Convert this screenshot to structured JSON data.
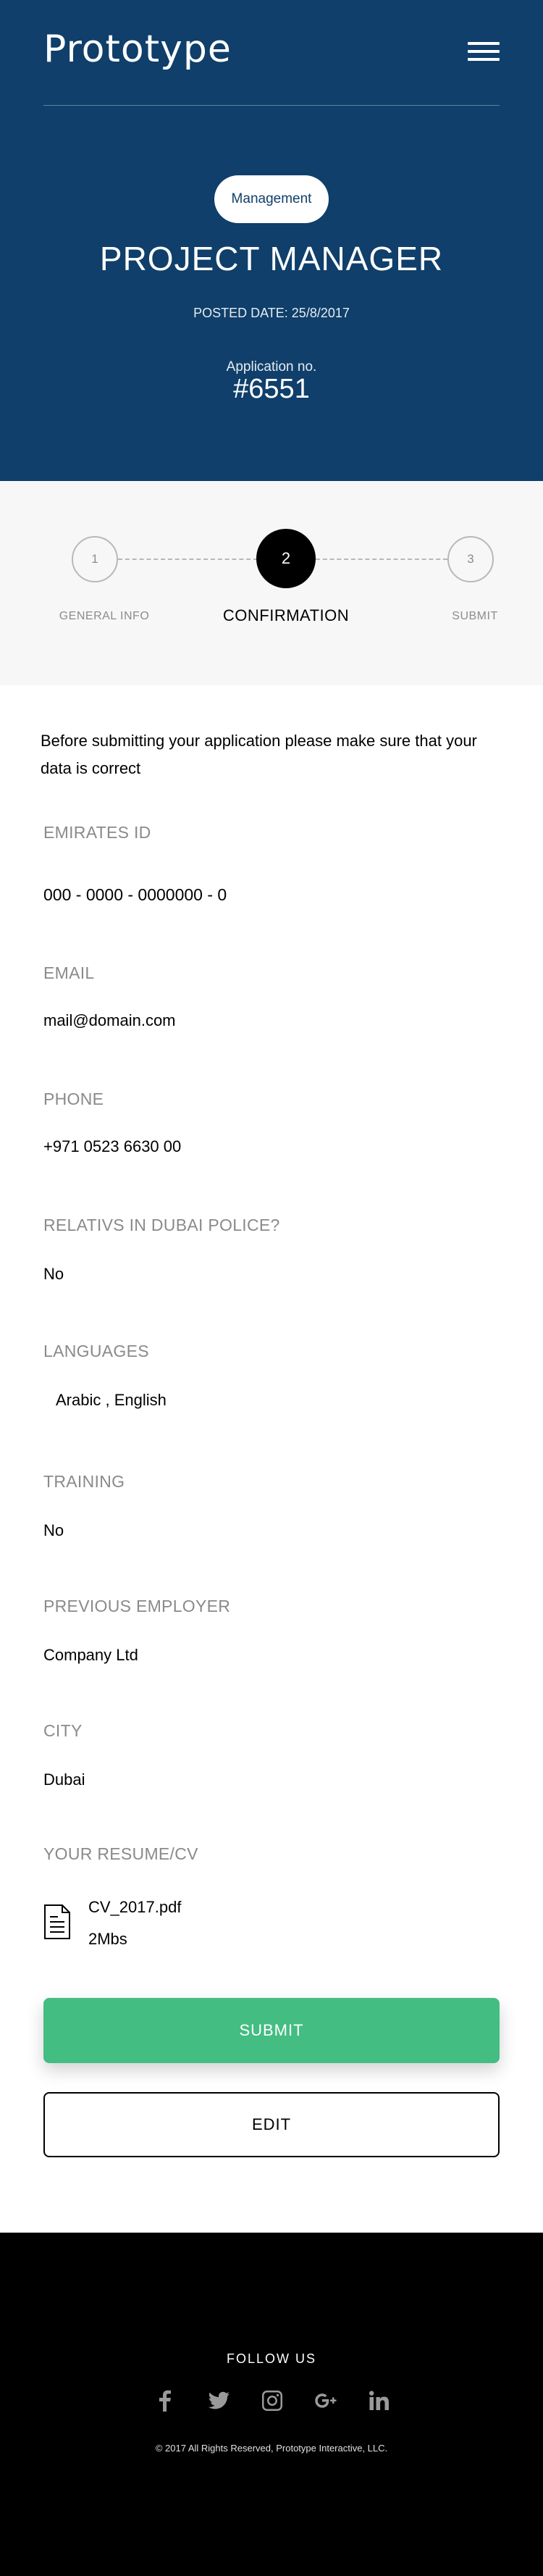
{
  "header": {
    "logo": "Prototype",
    "menu_icon": "hamburger-menu-icon",
    "category_tag": "Management",
    "job_title": "PROJECT MANAGER",
    "posted_date": "POSTED DATE: 25/8/2017",
    "application_label": "Application no.",
    "application_number": "#6551",
    "background_color": "#0f3f6a"
  },
  "stepper": {
    "steps": [
      {
        "number": "1",
        "label": "GENERAL INFO",
        "active": false
      },
      {
        "number": "2",
        "label": "CONFIRMATION",
        "active": true
      },
      {
        "number": "3",
        "label": "SUBMIT",
        "active": false
      }
    ]
  },
  "review": {
    "intro": "Before submitting your application please make sure that your data is correct",
    "fields": {
      "emirates_id": {
        "label": "EMIRATES ID",
        "value": "000 - 0000 - 0000000 - 0"
      },
      "email": {
        "label": "EMAIL",
        "value": "mail@domain.com"
      },
      "phone": {
        "label": "PHONE",
        "value": "+971 0523 6630 00"
      },
      "relatives": {
        "label": "RELATIVS IN DUBAI POLICE?",
        "value": "No"
      },
      "languages": {
        "label": "LANGUAGES",
        "value": "Arabic , English"
      },
      "training": {
        "label": "TRAINING",
        "value": "No"
      },
      "previous_employer": {
        "label": "PREVIOUS EMPLOYER",
        "value": "Company Ltd"
      },
      "city": {
        "label": "CITY",
        "value": "Dubai"
      }
    },
    "resume": {
      "label": "YOUR RESUME/CV",
      "file_name": "CV_2017.pdf",
      "file_size": "2Mbs",
      "icon": "document-icon"
    },
    "submit_label": "SUBMIT",
    "edit_label": "EDIT",
    "submit_color": "#43bd82"
  },
  "footer": {
    "follow_label": "FOLLOW US",
    "social_icons": [
      "facebook-icon",
      "twitter-icon",
      "instagram-icon",
      "google-plus-icon",
      "linkedin-icon"
    ],
    "copyright": "© 2017 All Rights Reserved, Prototype Interactive, LLC."
  }
}
